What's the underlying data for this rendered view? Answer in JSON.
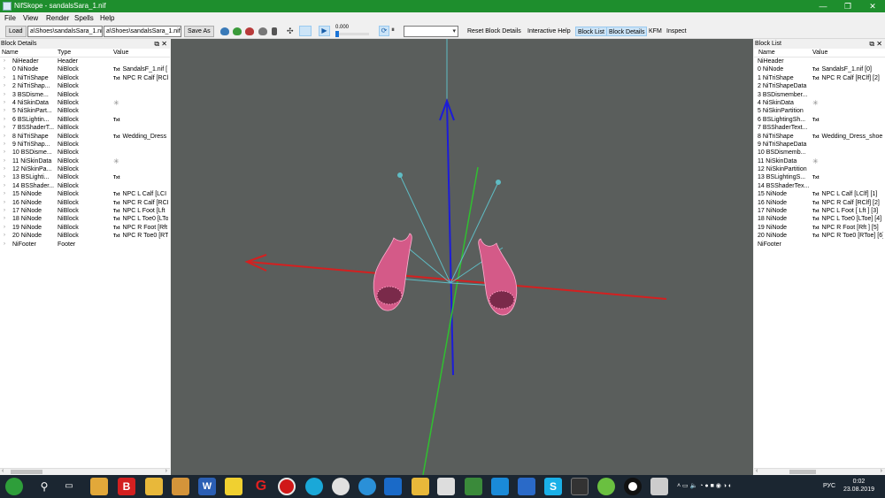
{
  "window": {
    "title": "NifSkope - sandalsSara_1.nif",
    "minimize": "—",
    "maximize": "❐",
    "close": "✕"
  },
  "menu": [
    "File",
    "View",
    "Render",
    "Spells",
    "Help"
  ],
  "toolbar": {
    "load": "Load",
    "path1": "a\\Shoes\\sandalsSara_1.nif",
    "path2": "a\\Shoes\\sandalsSara_1.nif",
    "save_as": "Save As",
    "time_value": "0.000",
    "reset_block_details": "Reset Block Details",
    "interactive_help": "Interactive Help",
    "block_list": "Block List",
    "block_details": "Block Details",
    "kfm": "KFM",
    "inspect": "Inspect"
  },
  "left_panel": {
    "title": "Block Details",
    "col_name": "Name",
    "col_type": "Type",
    "col_value": "Value",
    "rows": [
      {
        "name": "NiHeader",
        "type": "Header",
        "value": ""
      },
      {
        "name": "0 NiNode",
        "type": "NiBlock",
        "value": "SandalsF_1.nif [",
        "badge": "Txt"
      },
      {
        "name": "1 NiTriShape",
        "type": "NiBlock",
        "value": "NPC R Calf [RCl",
        "badge": "Txt"
      },
      {
        "name": "2 NiTriShap...",
        "type": "NiBlock",
        "value": ""
      },
      {
        "name": "3 BSDisme...",
        "type": "NiBlock",
        "value": ""
      },
      {
        "name": "4 NiSkinData",
        "type": "NiBlock",
        "value": "",
        "badge": "✳"
      },
      {
        "name": "5 NiSkinPart...",
        "type": "NiBlock",
        "value": ""
      },
      {
        "name": "6 BSLightin...",
        "type": "NiBlock",
        "value": "",
        "badge": "Txt"
      },
      {
        "name": "7 BSShaderT...",
        "type": "NiBlock",
        "value": ""
      },
      {
        "name": "8 NiTriShape",
        "type": "NiBlock",
        "value": "Wedding_Dress",
        "badge": "Txt"
      },
      {
        "name": "9 NiTriShap...",
        "type": "NiBlock",
        "value": ""
      },
      {
        "name": "10 BSDisme...",
        "type": "NiBlock",
        "value": ""
      },
      {
        "name": "11 NiSkinData",
        "type": "NiBlock",
        "value": "",
        "badge": "✳"
      },
      {
        "name": "12 NiSkinPa...",
        "type": "NiBlock",
        "value": ""
      },
      {
        "name": "13 BSLighti...",
        "type": "NiBlock",
        "value": "",
        "badge": "Txt"
      },
      {
        "name": "14 BSShader...",
        "type": "NiBlock",
        "value": ""
      },
      {
        "name": "15 NiNode",
        "type": "NiBlock",
        "value": "NPC L Calf [LCI",
        "badge": "Txt"
      },
      {
        "name": "16 NiNode",
        "type": "NiBlock",
        "value": "NPC R Calf [RCI",
        "badge": "Txt"
      },
      {
        "name": "17 NiNode",
        "type": "NiBlock",
        "value": "NPC L Foot [Lft",
        "badge": "Txt"
      },
      {
        "name": "18 NiNode",
        "type": "NiBlock",
        "value": "NPC L Toe0 [LTo",
        "badge": "Txt"
      },
      {
        "name": "19 NiNode",
        "type": "NiBlock",
        "value": "NPC R Foot [Rft",
        "badge": "Txt"
      },
      {
        "name": "20 NiNode",
        "type": "NiBlock",
        "value": "NPC R Toe0 [RT",
        "badge": "Txt"
      },
      {
        "name": "NiFooter",
        "type": "Footer",
        "value": ""
      }
    ]
  },
  "right_panel": {
    "title": "Block List",
    "col_name": "Name",
    "col_value": "Value",
    "rows": [
      {
        "name": "NiHeader",
        "value": ""
      },
      {
        "name": "0 NiNode",
        "value": "SandalsF_1.nif [0]",
        "badge": "Txt"
      },
      {
        "name": "1 NiTriShape",
        "value": "NPC R Calf [RClf] [2]",
        "badge": "Txt"
      },
      {
        "name": "2 NiTriShapeData",
        "value": ""
      },
      {
        "name": "3 BSDismember...",
        "value": ""
      },
      {
        "name": "4 NiSkinData",
        "value": "",
        "badge": "✳"
      },
      {
        "name": "5 NiSkinPartition",
        "value": ""
      },
      {
        "name": "6 BSLightingSh...",
        "value": "",
        "badge": "Txt"
      },
      {
        "name": "7 BSShaderText...",
        "value": ""
      },
      {
        "name": "8 NiTriShape",
        "value": "Wedding_Dress_shoe",
        "badge": "Txt"
      },
      {
        "name": "9 NiTriShapeData",
        "value": ""
      },
      {
        "name": "10 BSDismemb...",
        "value": ""
      },
      {
        "name": "11 NiSkinData",
        "value": "",
        "badge": "✳"
      },
      {
        "name": "12 NiSkinPartition",
        "value": ""
      },
      {
        "name": "13 BSLightingS...",
        "value": "",
        "badge": "Txt"
      },
      {
        "name": "14 BSShaderTex...",
        "value": ""
      },
      {
        "name": "15 NiNode",
        "value": "NPC L Calf [LClf] [1]",
        "badge": "Txt"
      },
      {
        "name": "16 NiNode",
        "value": "NPC R Calf [RClf] [2]",
        "badge": "Txt"
      },
      {
        "name": "17 NiNode",
        "value": "NPC L Foot [ Lft ] [3]",
        "badge": "Txt"
      },
      {
        "name": "18 NiNode",
        "value": "NPC L Toe0 [LToe] [4]",
        "badge": "Txt"
      },
      {
        "name": "19 NiNode",
        "value": "NPC R Foot [Rft ] [5]",
        "badge": "Txt"
      },
      {
        "name": "20 NiNode",
        "value": "NPC R Toe0 [RToe] [6]",
        "badge": "Txt"
      },
      {
        "name": "NiFooter",
        "value": ""
      }
    ]
  },
  "tray": {
    "lang": "РУС",
    "time": "0:02",
    "date": "23.08.2019"
  },
  "colors": {
    "titlebar": "#1e8e2d",
    "viewport": "#5a5e5c",
    "axis_x": "#d42020",
    "axis_y": "#1c1cd8",
    "axis_z": "#30c030",
    "bones": "#5fbcc4",
    "mesh": "#e0558e"
  }
}
